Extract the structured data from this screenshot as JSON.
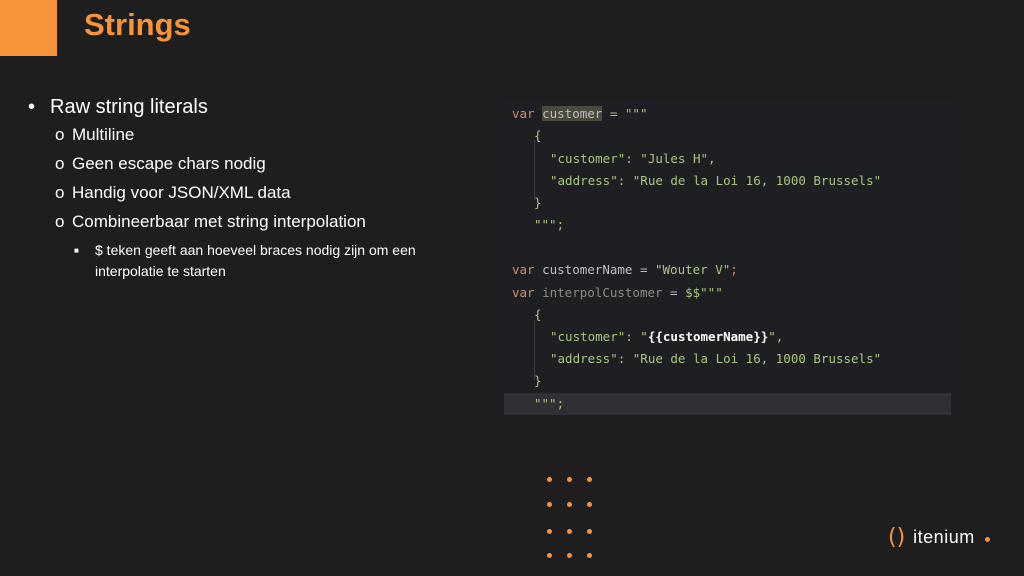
{
  "slide": {
    "title": "Strings",
    "accent_color": "#f7943a"
  },
  "bullets": {
    "level1": "Raw string literals",
    "level2": [
      "Multiline",
      "Geen escape chars nodig",
      "Handig voor JSON/XML data",
      "Combineerbaar met string interpolation"
    ],
    "level3": "$ teken geeft aan hoeveel braces nodig zijn om een interpolatie te starten",
    "marks": {
      "l1": "•",
      "l2": "o",
      "l3": "■"
    }
  },
  "code": {
    "line1": {
      "kw": "var",
      "id": "customer",
      "rest": " = \"\"\""
    },
    "line2": "{",
    "line3": "\"customer\": \"Jules H\",",
    "line4": "\"address\": \"Rue de la Loi 16, 1000 Brussels\"",
    "line5": "}",
    "line6": "\"\"\";",
    "line7": {
      "kw": "var",
      "id": "customerName",
      "op": " = ",
      "str": "\"Wouter V\"",
      "end": ";"
    },
    "line8": {
      "kw": "var",
      "id": "interpolCustomer",
      "op": " = ",
      "str": "$$\"\"\""
    },
    "line9": "{",
    "line10": {
      "pre": "\"customer\": \"",
      "interp": "{{customerName}}",
      "post": "\","
    },
    "line11": "\"address\": \"Rue de la Loi 16, 1000 Brussels\"",
    "line12": "}",
    "line13": "\"\"\";"
  },
  "logo": {
    "text": "itenium",
    "mark": "()"
  }
}
